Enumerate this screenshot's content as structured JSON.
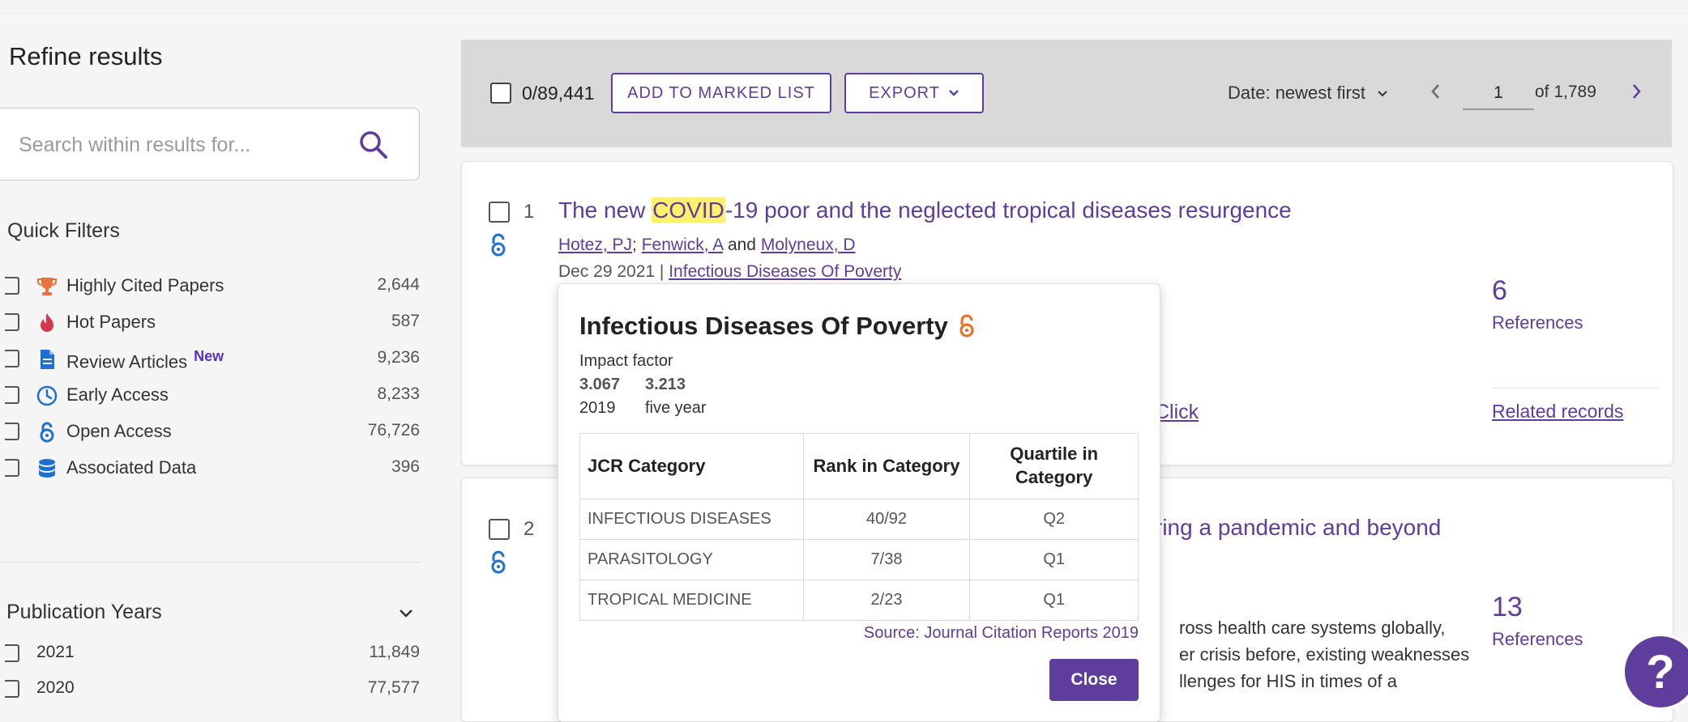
{
  "sidebar": {
    "refine_title": "Refine results",
    "search_placeholder": "Search within results for...",
    "quick_filters_title": "Quick Filters",
    "quick_filters": [
      {
        "label": "Highly Cited Papers",
        "count": "2,644",
        "icon": "trophy-icon"
      },
      {
        "label": "Hot Papers",
        "count": "587",
        "icon": "flame-icon"
      },
      {
        "label": "Review Articles",
        "badge": "New",
        "count": "9,236",
        "icon": "document-icon"
      },
      {
        "label": "Early Access",
        "count": "8,233",
        "icon": "clock-icon"
      },
      {
        "label": "Open Access",
        "count": "76,726",
        "icon": "open-access-icon"
      },
      {
        "label": "Associated Data",
        "count": "396",
        "icon": "database-icon"
      }
    ],
    "publication_years_title": "Publication Years",
    "publication_years": [
      {
        "label": "2021",
        "count": "11,849"
      },
      {
        "label": "2020",
        "count": "77,577"
      }
    ]
  },
  "toolbar": {
    "selection_count": "0/89,441",
    "add_to_marked_list": "ADD TO MARKED LIST",
    "export": "EXPORT",
    "sort": "Date: newest first",
    "page_value": "1",
    "page_of": "of  1,789"
  },
  "results": [
    {
      "number": "1",
      "title_before": "The new ",
      "title_highlight": "COVID",
      "title_after": "-19 poor and the neglected tropical diseases resurgence",
      "authors": [
        "Hotez, PJ",
        "Fenwick, A",
        "Molyneux, D"
      ],
      "author_sep": "; ",
      "author_and": " and ",
      "date": "Dec 29 2021",
      "meta_sep": " | ",
      "journal": "Infectious Diseases Of Poverty",
      "references_count": "6",
      "references_label": "References",
      "partial_link": "Click",
      "related": "Related records"
    },
    {
      "number": "2",
      "title_visible": "ring a pandemic and beyond",
      "abstract_lines": [
        "ross health care systems globally,",
        "er crisis before, existing weaknesses",
        "llenges for HIS in times of a"
      ],
      "references_count": "13",
      "references_label": "References"
    }
  ],
  "popup": {
    "journal_title": "Infectious Diseases Of Poverty",
    "impact_factor_label": "Impact factor",
    "if_values": [
      "3.067",
      "3.213"
    ],
    "if_years": [
      "2019",
      "five year"
    ],
    "table_headers": [
      "JCR Category",
      "Rank in Category",
      "Quartile in Category"
    ],
    "table_rows": [
      [
        "INFECTIOUS DISEASES",
        "40/92",
        "Q2"
      ],
      [
        "PARASITOLOGY",
        "7/38",
        "Q1"
      ],
      [
        "TROPICAL MEDICINE",
        "2/23",
        "Q1"
      ]
    ],
    "source": "Source: Journal Citation Reports 2019",
    "close": "Close"
  },
  "help": {
    "label": "?"
  },
  "colors": {
    "accent": "#5e3d9c",
    "highlight": "#fdf06b",
    "toolbar_bg": "#d9d9d9",
    "open_access": "#ef6c1a",
    "trophy": "#e8743b",
    "flame": "#d4374f",
    "icon_blue": "#1f6fd1"
  }
}
